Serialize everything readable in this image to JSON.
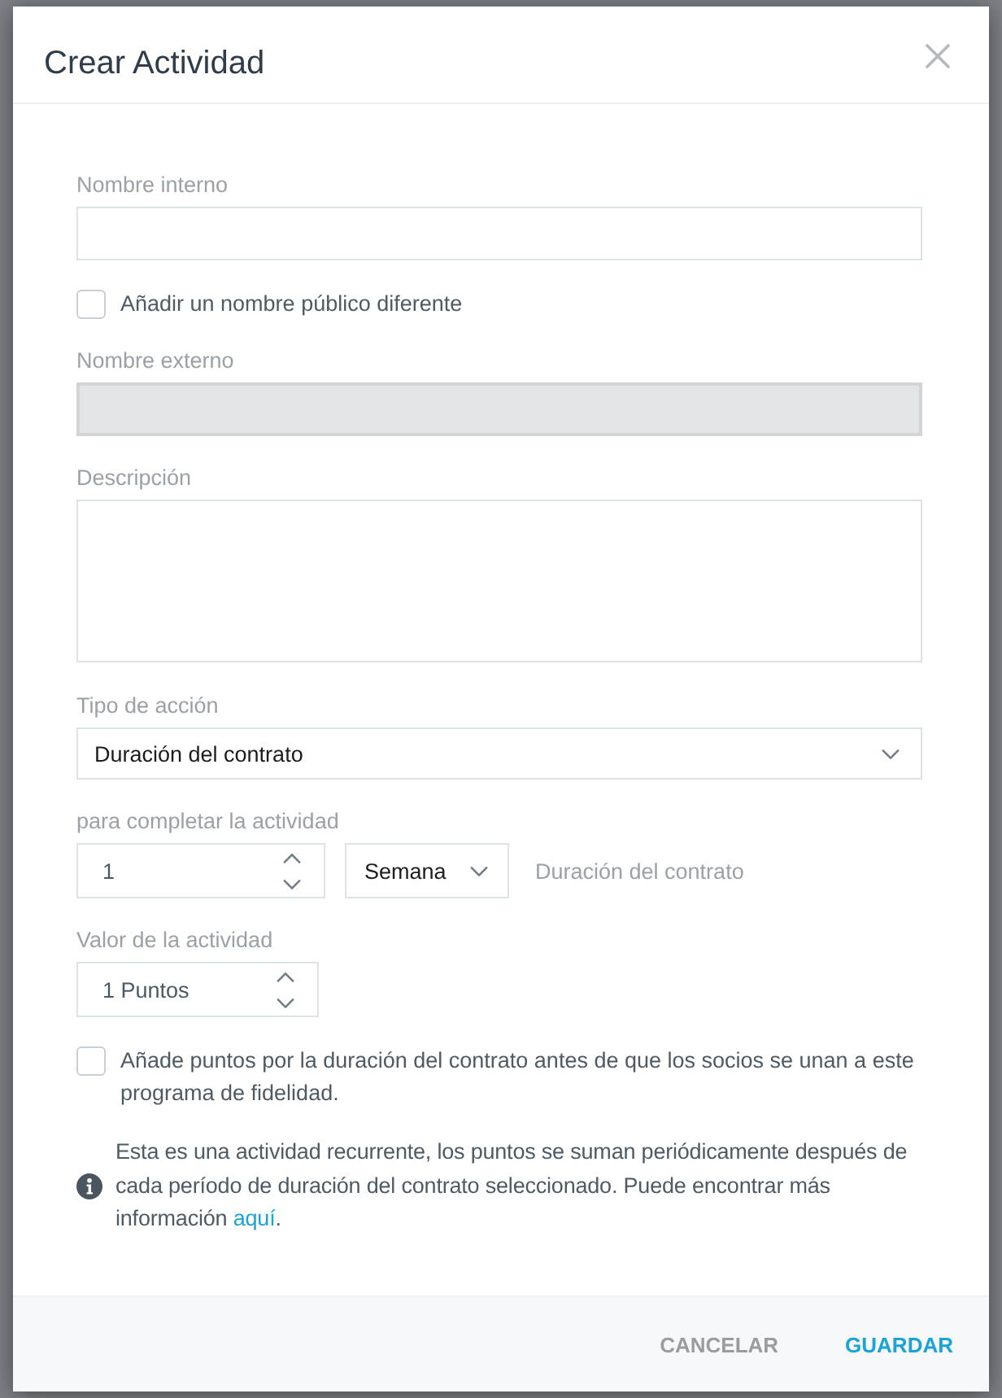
{
  "dialog": {
    "title": "Crear Actividad"
  },
  "fields": [
    {
      "kind": "text",
      "label": "Nombre interno",
      "disabled": false
    },
    {
      "kind": "checkbox",
      "label": "Añadir un nombre público diferente",
      "checked": false
    },
    {
      "kind": "text",
      "label": "Nombre externo",
      "disabled": true
    },
    {
      "kind": "textarea",
      "label": "Descripción"
    },
    {
      "kind": "select",
      "label": "Tipo de acción",
      "value": "Duración del contrato"
    },
    {
      "kind": "duration",
      "label": "para completar la actividad",
      "value": "1",
      "unit": "Semana",
      "note": "Duración del contrato"
    },
    {
      "kind": "number",
      "label": "Valor de la actividad",
      "value": "1 Puntos"
    },
    {
      "kind": "checkbox",
      "label": "Añade puntos por la duración del contrato antes de que los socios se unan a este programa de fidelidad.",
      "checked": false
    }
  ],
  "info": {
    "text": "Esta es una actividad recurrente, los puntos se suman periódicamente después de cada período de duración del contrato seleccionado. Puede encontrar más información",
    "link": "aquí",
    "end": "."
  },
  "buttons": [
    {
      "label": "CANCELAR",
      "kind": "secondary"
    },
    {
      "label": "GUARDAR",
      "kind": "primary"
    }
  ]
}
